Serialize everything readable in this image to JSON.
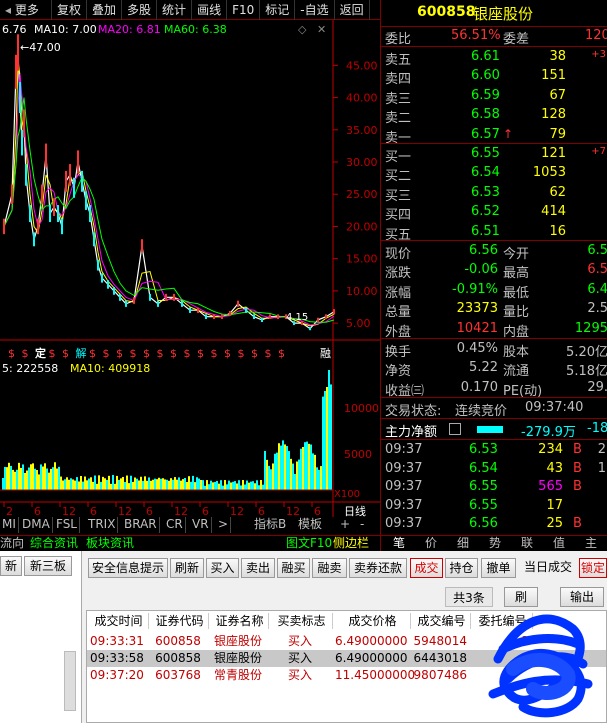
{
  "toolbar": {
    "items": [
      "更多",
      "复权",
      "叠加",
      "多股",
      "统计",
      "画线",
      "F10",
      "标记",
      "-自选",
      "返回"
    ]
  },
  "chart": {
    "legend_price": "6.76",
    "legend_ma10": "MA10: 7.00",
    "legend_ma20": "MA20: 6.81",
    "legend_ma60": "MA60: 6.38",
    "peak_label": "47.00",
    "low_label": "4.15",
    "price_ticks": [
      "45.00",
      "40.00",
      "35.00",
      "30.00",
      "25.00",
      "20.00",
      "15.00",
      "10.00",
      "5.00"
    ],
    "volume_legend_vol": "5: 222558",
    "volume_legend_ma10": "MA10: 409918",
    "volume_ticks": [
      "10000",
      "5000",
      "X100"
    ],
    "x_ticks": [
      "2",
      "6",
      "12",
      "6",
      "12",
      "6",
      "12",
      "6",
      "12",
      "6",
      "12",
      "6"
    ],
    "period_label": "日线",
    "event_markers": [
      "$",
      "$",
      "定",
      "$",
      "$",
      "解",
      "$",
      "$",
      "$",
      "$",
      "$",
      "$",
      "$",
      "$",
      "$",
      "$",
      "$",
      "$",
      "$",
      "$",
      "$"
    ],
    "event_last": "融",
    "indicator_tabs": [
      "MI",
      "DMA",
      "FSL",
      "TRIX",
      "BRAR",
      "CR",
      "VR",
      ">"
    ],
    "indicator_right": [
      "指标B",
      "模板",
      "+",
      "-"
    ],
    "colors": {
      "price_line": "#ffffff",
      "ma_yellow": "#ffff00",
      "ma_magenta": "#ff00ff",
      "ma_green": "#00ff00",
      "axis_red": "#c00000",
      "up_red": "#ff3232",
      "down_cyan": "#00ffff"
    }
  },
  "chart_data": {
    "type": "line",
    "title": "",
    "x": [
      0,
      8,
      12,
      14,
      16,
      18,
      20,
      22,
      26,
      30,
      34,
      38,
      42,
      46,
      50,
      54,
      58,
      62,
      66,
      70,
      74,
      78,
      82,
      86,
      90,
      94,
      98,
      104,
      110,
      116,
      122,
      130,
      138,
      146,
      154,
      162,
      170,
      178,
      186,
      194,
      202,
      210,
      218,
      226,
      234,
      242,
      250,
      258,
      266,
      274,
      282,
      290,
      298,
      306,
      314,
      322,
      330
    ],
    "series": [
      {
        "values": [
          20,
          25,
          44,
          47,
          40,
          33,
          36,
          28,
          22,
          18,
          20,
          25,
          31,
          22,
          23,
          22,
          20,
          27,
          28,
          26,
          30,
          27,
          24,
          22,
          18,
          14,
          12,
          11,
          10,
          9,
          8,
          8.5,
          17,
          9,
          8,
          9,
          9,
          8,
          7,
          7,
          6,
          6,
          6,
          6.5,
          8,
          7,
          6,
          5.5,
          6,
          6,
          6,
          5,
          5,
          4.15,
          5.5,
          6,
          6.76
        ]
      }
    ],
    "xlabel": "",
    "ylabel": "",
    "ylim": [
      3,
      48
    ],
    "grid": false
  },
  "quote": {
    "code": "600858",
    "name": "银座股份",
    "weibi_label": "委比",
    "weibi_value": "56.51%",
    "weicha_label": "委差",
    "weicha_value": "120",
    "sell": [
      {
        "label": "卖五",
        "price": "6.61",
        "vol": "38",
        "chg": "+3"
      },
      {
        "label": "卖四",
        "price": "6.60",
        "vol": "151",
        "chg": ""
      },
      {
        "label": "卖三",
        "price": "6.59",
        "vol": "67",
        "chg": ""
      },
      {
        "label": "卖二",
        "price": "6.58",
        "vol": "128",
        "chg": ""
      },
      {
        "label": "卖一",
        "price": "6.57",
        "vol": "79",
        "chg": ""
      }
    ],
    "buy": [
      {
        "label": "买一",
        "price": "6.55",
        "vol": "121",
        "chg": "+7"
      },
      {
        "label": "买二",
        "price": "6.54",
        "vol": "1053",
        "chg": ""
      },
      {
        "label": "买三",
        "price": "6.53",
        "vol": "62",
        "chg": ""
      },
      {
        "label": "买四",
        "price": "6.52",
        "vol": "414",
        "chg": ""
      },
      {
        "label": "买五",
        "price": "6.51",
        "vol": "16",
        "chg": ""
      }
    ],
    "stats": [
      {
        "l1": "现价",
        "v1": "6.56",
        "l2": "今开",
        "v2": "6.5"
      },
      {
        "l1": "涨跌",
        "v1": "-0.06",
        "l2": "最高",
        "v2": "6.5"
      },
      {
        "l1": "涨幅",
        "v1": "-0.91%",
        "l2": "最低",
        "v2": "6.4"
      },
      {
        "l1": "总量",
        "v1": "23373",
        "l2": "量比",
        "v2": "2.5"
      },
      {
        "l1": "外盘",
        "v1": "10421",
        "l2": "内盘",
        "v2": "1295"
      }
    ],
    "stats2": [
      {
        "l1": "换手",
        "v1": "0.45%",
        "l2": "股本",
        "v2": "5.20亿"
      },
      {
        "l1": "净资",
        "v1": "5.22",
        "l2": "流通",
        "v2": "5.18亿"
      },
      {
        "l1": "收益㈢",
        "v1": "0.170",
        "l2": "PE(动)",
        "v2": "29."
      }
    ],
    "trade_status_label": "交易状态:",
    "trade_status_value": "连续竞价",
    "trade_status_time": "09:37:40",
    "main_flow_label": "主力净额",
    "main_flow_value": "-279.9万",
    "main_flow_pct": "-18",
    "ticks": [
      {
        "time": "09:37",
        "price": "6.53",
        "vol": "234",
        "side": "B",
        "n": "2"
      },
      {
        "time": "09:37",
        "price": "6.54",
        "vol": "43",
        "side": "B",
        "n": "1"
      },
      {
        "time": "09:37",
        "price": "6.55",
        "vol": "565",
        "side": "B",
        "n": ""
      },
      {
        "time": "09:37",
        "price": "6.55",
        "vol": "17",
        "side": "",
        "n": ""
      },
      {
        "time": "09:37",
        "price": "6.56",
        "vol": "25",
        "side": "B",
        "n": ""
      }
    ]
  },
  "bottom_tabs": {
    "left": [
      "流向",
      "综合资讯",
      "板块资讯"
    ],
    "right_label": "图文F10",
    "right_label2": "侧边栏",
    "right_tabs": [
      "笔",
      "价",
      "细",
      "势",
      "联",
      "值",
      "主"
    ]
  },
  "trade": {
    "left_items": [
      "新",
      "新三板"
    ],
    "buttons": [
      "安全信息提示",
      "刷新",
      "买入",
      "卖出",
      "融买",
      "融卖",
      "卖券还款",
      "成交",
      "持仓",
      "撤单",
      "当日成交",
      "锁定"
    ],
    "total_label": "共3条",
    "refresh_label": "刷",
    "output_label": "输出",
    "columns": [
      "成交时间",
      "证券代码",
      "证券名称",
      "买卖标志",
      "成交价格",
      "成交编号",
      "委托编号"
    ],
    "rows": [
      {
        "time": "09:33:31",
        "code": "600858",
        "name": "银座股份",
        "side": "买入",
        "price": "6.49000000",
        "id": "5948014",
        "order": "3"
      },
      {
        "time": "09:33:58",
        "code": "600858",
        "name": "银座股份",
        "side": "买入",
        "price": "6.49000000",
        "id": "6443018",
        "order": ""
      },
      {
        "time": "09:37:20",
        "code": "603768",
        "name": "常青股份",
        "side": "买入",
        "price": "11.45000000",
        "id": "9807486",
        "order": ""
      }
    ]
  }
}
